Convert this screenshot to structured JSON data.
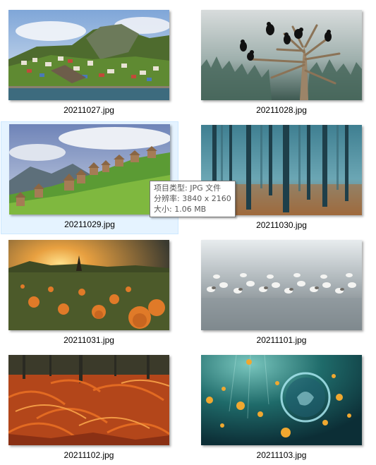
{
  "files": [
    {
      "name": "20211027.jpg",
      "thumbnail": "coastal-hillside-village-landscape"
    },
    {
      "name": "20211028.jpg",
      "thumbnail": "crows-on-dead-tree-foggy-forest"
    },
    {
      "name": "20211029.jpg",
      "thumbnail": "stone-crypts-on-green-mountain-slope"
    },
    {
      "name": "20211030.jpg",
      "thumbnail": "misty-blue-forest-trees"
    },
    {
      "name": "20211031.jpg",
      "thumbnail": "pumpkin-field-at-sunset"
    },
    {
      "name": "20211101.jpg",
      "thumbnail": "flock-of-shorebirds-on-water"
    },
    {
      "name": "20211102.jpg",
      "thumbnail": "orange-autumn-ferns-forest"
    },
    {
      "name": "20211103.jpg",
      "thumbnail": "underwater-jellyfish-scene"
    }
  ],
  "selected_file": "20211029.jpg",
  "tooltip": {
    "type_line": "项目类型: JPG 文件",
    "dimensions_line": "分辨率: 3840 x 2160",
    "size_line": "大小: 1.06 MB"
  },
  "colors": {
    "selection_background": "#e5f3ff",
    "selection_border": "#cce8ff",
    "tooltip_text": "#575757",
    "tooltip_border": "#767676"
  }
}
